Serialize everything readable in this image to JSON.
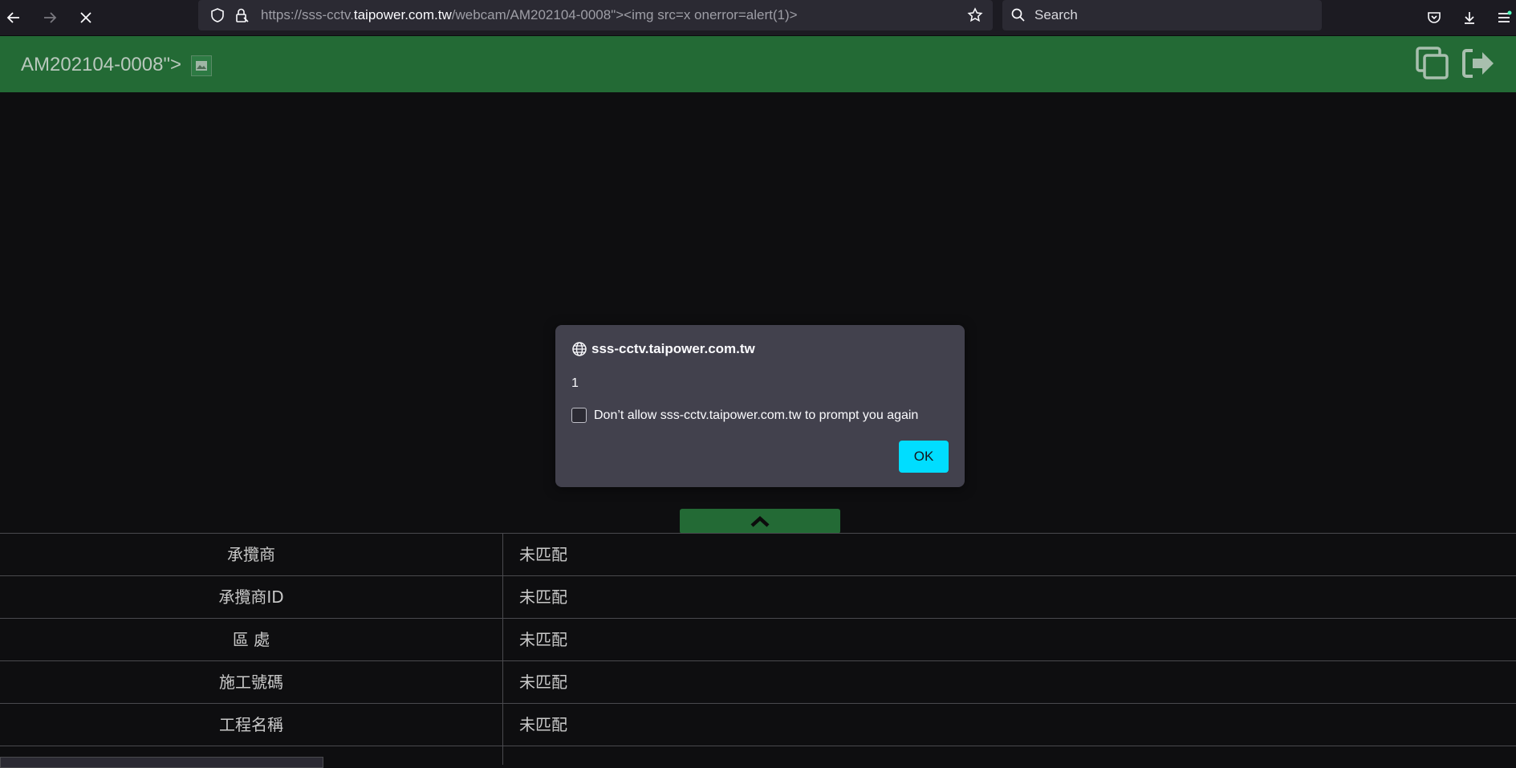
{
  "browser": {
    "url_prefix": "https://sss-cctv.",
    "url_host": "taipower.com.tw",
    "url_suffix": "/webcam/AM202104-0008\"><img src=x onerror=alert(1)>",
    "search_placeholder": "Search",
    "icons": [
      "back-arrow-icon",
      "forward-arrow-icon",
      "stop-loading-icon",
      "shield-icon",
      "lock-icon",
      "star-icon",
      "search-icon",
      "pocket-icon",
      "download-icon",
      "menu-icon"
    ]
  },
  "header": {
    "camera_title": "AM202104-0008\">",
    "icons": [
      "copy-icon",
      "logout-icon"
    ],
    "bg_color": "#236a35"
  },
  "dialog": {
    "origin": "sss-cctv.taipower.com.tw",
    "message": "1",
    "checkbox_label": "Don’t allow sss-cctv.taipower.com.tw to prompt you again",
    "checkbox_checked": false,
    "ok_label": "OK",
    "ok_color": "#00ddff"
  },
  "info_table": {
    "rows": [
      {
        "label": "承攬商",
        "value": "未匹配"
      },
      {
        "label": "承攬商ID",
        "value": "未匹配"
      },
      {
        "label": "區 處",
        "value": "未匹配"
      },
      {
        "label": "施工號碼",
        "value": "未匹配"
      },
      {
        "label": "工程名稱",
        "value": "未匹配"
      }
    ]
  }
}
